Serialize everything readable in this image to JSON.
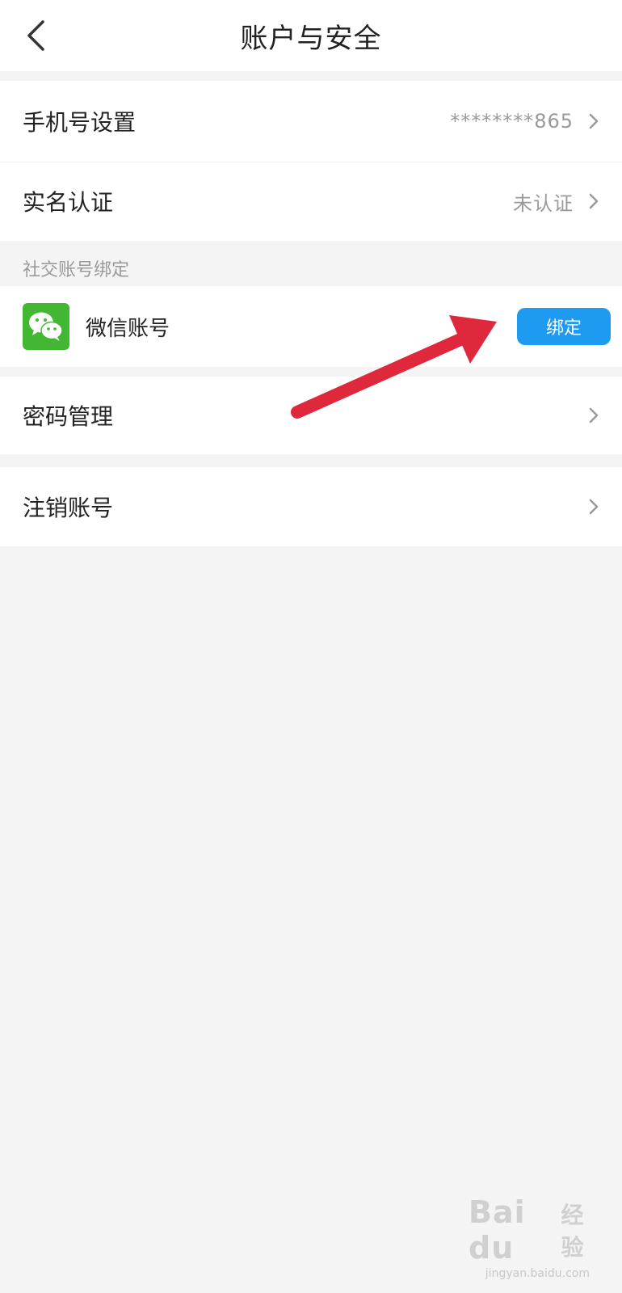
{
  "header": {
    "title": "账户与安全"
  },
  "account": {
    "phone_label": "手机号设置",
    "phone_value": "********865",
    "realname_label": "实名认证",
    "realname_value": "未认证"
  },
  "social": {
    "section_title": "社交账号绑定",
    "wechat_label": "微信账号",
    "bind_label": "绑定"
  },
  "password": {
    "label": "密码管理"
  },
  "deregister": {
    "label": "注销账号"
  },
  "watermark": {
    "brand": "Bai du",
    "suffix": "经验",
    "url": "jingyan.baidu.com"
  },
  "colors": {
    "accent": "#1e9bf0",
    "wechat_green": "#43b734",
    "annotation_arrow": "#e0283c",
    "background": "#f4f4f4"
  },
  "icons": {
    "back": "chevron-left-icon",
    "row_arrow": "chevron-right-icon",
    "wechat": "wechat-logo-icon"
  }
}
